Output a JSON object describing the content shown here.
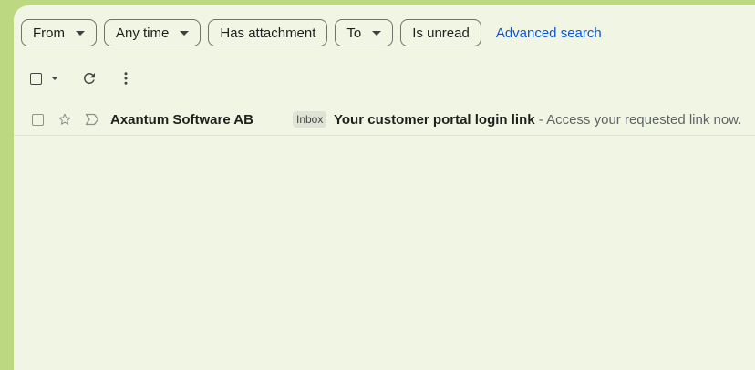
{
  "filters": {
    "chips": [
      {
        "label": "From",
        "has_dropdown": true
      },
      {
        "label": "Any time",
        "has_dropdown": true
      },
      {
        "label": "Has attachment",
        "has_dropdown": false
      },
      {
        "label": "To",
        "has_dropdown": true
      },
      {
        "label": "Is unread",
        "has_dropdown": false
      }
    ],
    "advanced_search_label": "Advanced search"
  },
  "toolbar": {
    "icons": [
      "checkbox-icon",
      "chevron-down-icon",
      "refresh-icon",
      "more-vert-icon"
    ]
  },
  "messages": [
    {
      "sender": "Axantum Software AB",
      "label": "Inbox",
      "subject": "Your customer portal login link",
      "snippet": " - Access your requested link now.",
      "starred": false,
      "unread": true
    }
  ],
  "colors": {
    "frame": "#bcd982",
    "panel": "#f1f5e4",
    "link": "#0b57d0"
  }
}
